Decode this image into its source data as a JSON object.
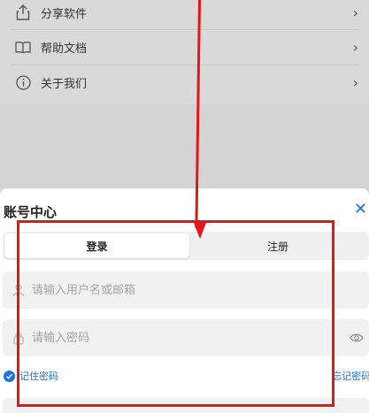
{
  "menu": {
    "items": [
      {
        "label": "分享软件",
        "icon": "share-icon"
      },
      {
        "label": "帮助文档",
        "icon": "book-icon"
      },
      {
        "label": "关于我们",
        "icon": "info-icon"
      }
    ]
  },
  "sheet": {
    "title": "账号中心",
    "tabs": [
      {
        "label": "登录",
        "active": true
      },
      {
        "label": "注册",
        "active": false
      }
    ],
    "username": {
      "placeholder": "请输入用户名或邮箱",
      "value": ""
    },
    "password": {
      "placeholder": "请输入密码",
      "value": ""
    },
    "remember_label": "记住密码",
    "forgot_label": "忘记密码?"
  },
  "colors": {
    "accent": "#1a73e8",
    "annotation": "#e01818"
  }
}
